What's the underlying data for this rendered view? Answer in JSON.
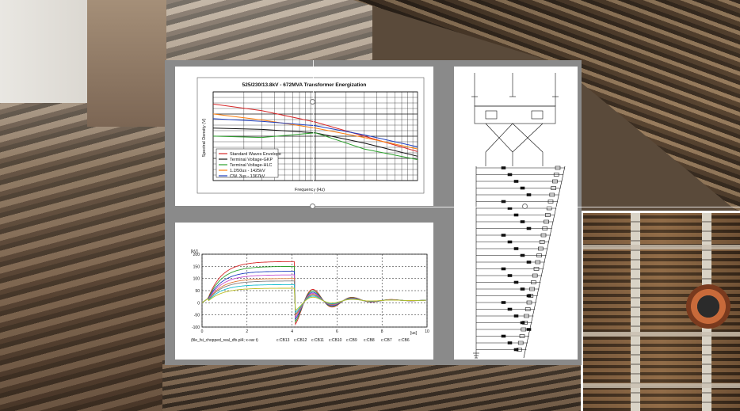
{
  "top_chart": {
    "title": "525/230/13.8kV - 672MVA Transformer Energization",
    "ylabel": "Spectral Density (V)",
    "xlabel": "Frequency (Hz)",
    "legend": [
      {
        "label": "Standard Waves Envelope",
        "color": "#d62728"
      },
      {
        "label": "Terminal Voltage-GKP",
        "color": "#111111"
      },
      {
        "label": "Terminal Voltage-HLC",
        "color": "#2ca02c"
      },
      {
        "label": "1.2/50us - 1425kV",
        "color": "#ff7f0e"
      },
      {
        "label": "CW. 3us - 1367kV",
        "color": "#1f3fbf"
      }
    ]
  },
  "bottom_chart": {
    "footer_label": "(file_fsi_chopped_real_dfx.pl4; x-var t)",
    "x_unit": "[us]",
    "y_unit": "[kV]",
    "series_labels": [
      "c:CB13",
      "c:CB12",
      "c:CB11",
      "c:CB10",
      "c:CB9",
      "c:CB8",
      "c:CB7",
      "c:CB6"
    ],
    "series_colors": [
      "#d62728",
      "#2ca02c",
      "#1f3fbf",
      "#c44ccf",
      "#e07b39",
      "#7f7f7f",
      "#17becf",
      "#bcbd22"
    ]
  },
  "chart_data": [
    {
      "type": "line",
      "title": "525/230/13.8kV - 672MVA Transformer Energization",
      "xlabel": "Frequency (Hz)",
      "ylabel": "Spectral Density (V)",
      "xscale": "log",
      "yscale": "log",
      "xlim": [
        1000,
        100000
      ],
      "series": [
        {
          "name": "Standard Waves Envelope",
          "x": [
            1000,
            3000,
            10000,
            30000,
            100000
          ],
          "y": [
            700,
            400,
            150,
            45,
            12
          ]
        },
        {
          "name": "Terminal Voltage-GKP",
          "x": [
            1000,
            3000,
            10000,
            30000,
            100000
          ],
          "y": [
            90,
            80,
            60,
            25,
            8
          ]
        },
        {
          "name": "Terminal Voltage-HLC",
          "x": [
            1000,
            3000,
            10000,
            30000,
            100000
          ],
          "y": [
            45,
            40,
            60,
            15,
            6
          ]
        },
        {
          "name": "1.2/50us - 1425kV",
          "x": [
            1000,
            3000,
            10000,
            30000,
            100000
          ],
          "y": [
            300,
            180,
            90,
            40,
            15
          ]
        },
        {
          "name": "CW. 3us - 1367kV",
          "x": [
            1000,
            3000,
            10000,
            30000,
            100000
          ],
          "y": [
            200,
            160,
            110,
            50,
            18
          ]
        }
      ],
      "grid": true,
      "legend": "bottom-left"
    },
    {
      "type": "line",
      "x_unit": "[us]",
      "y_unit": "[kV]",
      "xlim": [
        0,
        10
      ],
      "ylim": [
        -100,
        200
      ],
      "x_ticks": [
        0,
        2,
        4,
        6,
        8,
        10
      ],
      "y_ticks": [
        -100,
        -50,
        0,
        50,
        100,
        150,
        200
      ],
      "series": [
        {
          "name": "c:CB13",
          "peak": 170
        },
        {
          "name": "c:CB12",
          "peak": 150
        },
        {
          "name": "c:CB11",
          "peak": 130
        },
        {
          "name": "c:CB10",
          "peak": 115
        },
        {
          "name": "c:CB9",
          "peak": 100
        },
        {
          "name": "c:CB8",
          "peak": 90
        },
        {
          "name": "c:CB7",
          "peak": 75
        },
        {
          "name": "c:CB6",
          "peak": 60
        }
      ],
      "grid": true,
      "legend": "bottom"
    }
  ]
}
